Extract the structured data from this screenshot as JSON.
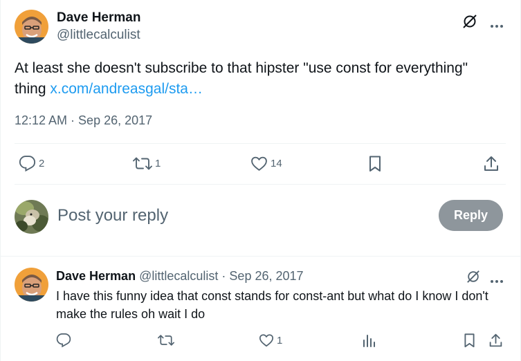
{
  "main_tweet": {
    "author_name": "Dave Herman",
    "author_handle": "@littlecalculist",
    "text": "At least she doesn't subscribe to that hipster \"use const for everything\" thing ",
    "link_text": "x.com/andreasgal/sta…",
    "timestamp": "12:12 AM · Sep 26, 2017",
    "actions": {
      "replies": "2",
      "reposts": "1",
      "likes": "14"
    }
  },
  "compose": {
    "placeholder": "Post your reply",
    "button_label": "Reply"
  },
  "reply_tweet": {
    "author_name": "Dave Herman",
    "author_handle": "@littlecalculist",
    "separator": "·",
    "date": "Sep 26, 2017",
    "text": "I have this funny idea that const stands for const-ant but what do I know I don't make the rules oh wait I do",
    "actions": {
      "likes": "1"
    }
  },
  "colors": {
    "accent": "#1d9bf0",
    "secondary_text": "#536471",
    "reply_button_disabled": "#8e969c"
  }
}
